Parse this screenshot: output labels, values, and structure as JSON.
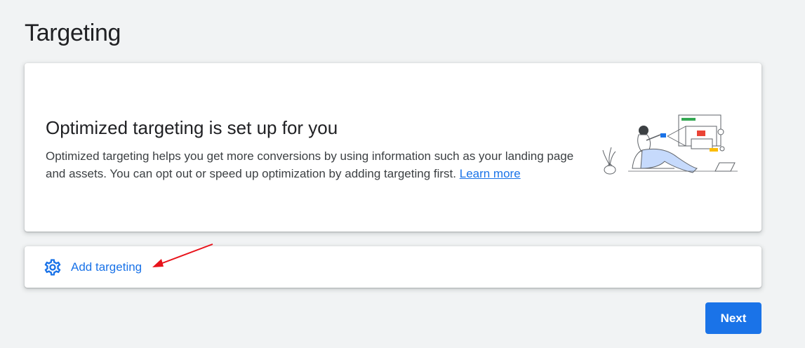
{
  "page": {
    "title": "Targeting"
  },
  "optimized_card": {
    "heading": "Optimized targeting is set up for you",
    "body": "Optimized targeting helps you get more conversions by using information such as your landing page and assets. You can opt out or speed up optimization by adding targeting first.",
    "link_label": "Learn more",
    "illustration_icon": "person-with-browser-windows-illustration"
  },
  "add_targeting": {
    "label": "Add targeting",
    "icon": "gear-icon"
  },
  "footer": {
    "next_label": "Next"
  },
  "colors": {
    "accent": "#1a73e8",
    "background": "#f1f3f4",
    "annotation": "#e8131b"
  }
}
